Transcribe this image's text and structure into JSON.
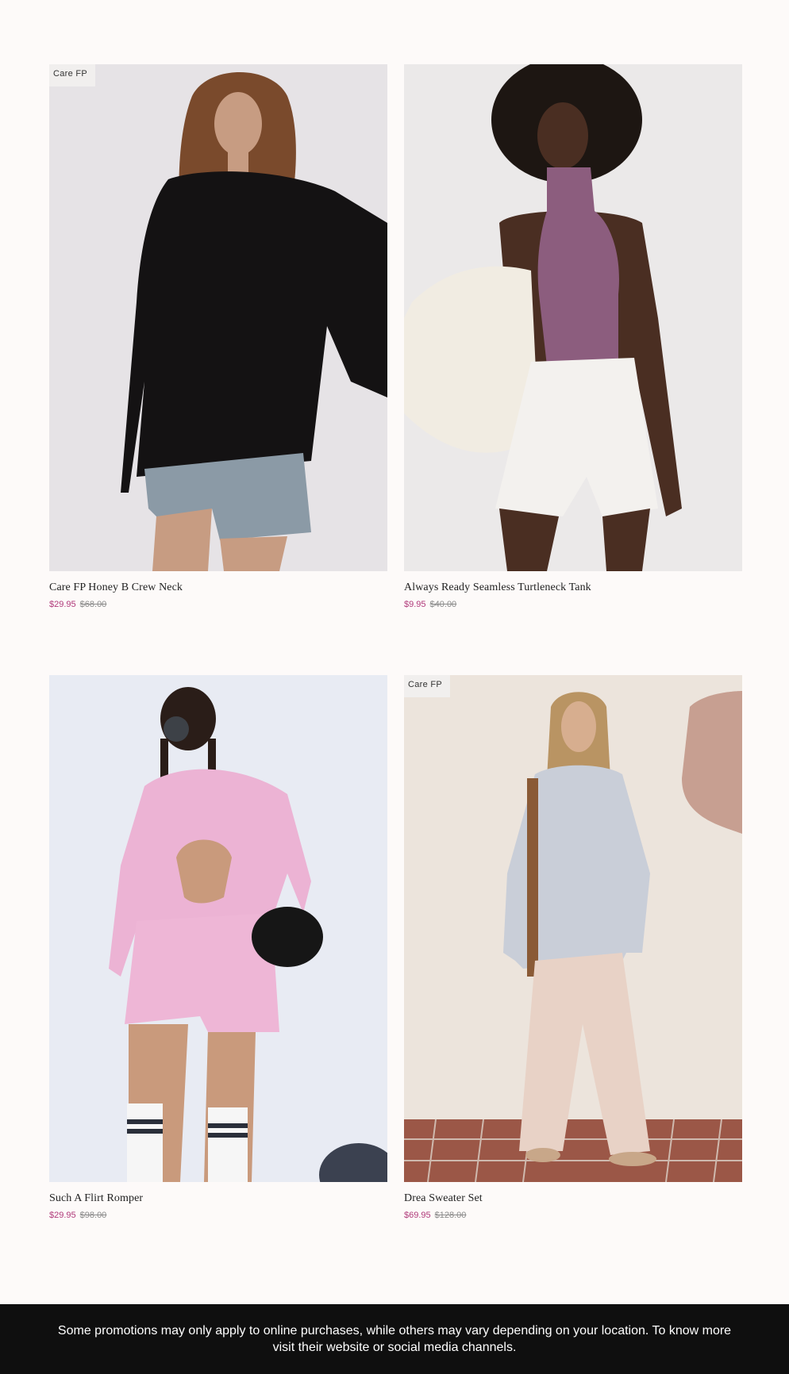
{
  "products": [
    {
      "badge": "Care FP",
      "title": "Care FP Honey B Crew Neck",
      "sale_price": "$29.95",
      "original_price": "$68.00",
      "colors": {
        "bg": "#e6e3e6",
        "top": "#141213",
        "bottom": "#8b9aa6",
        "skin": "#c79c82",
        "hair": "#7a4a2c"
      }
    },
    {
      "badge": "",
      "title": "Always Ready Seamless Turtleneck Tank",
      "sale_price": "$9.95",
      "original_price": "$40.00",
      "colors": {
        "bg": "#ebe9e9",
        "top": "#8c5d7e",
        "bottom": "#f3f1ee",
        "skin": "#4a2e22",
        "hair": "#1d1612"
      }
    },
    {
      "badge": "",
      "title": "Such A Flirt Romper",
      "sale_price": "$29.95",
      "original_price": "$98.00",
      "colors": {
        "bg": "#e8ebf3",
        "top": "#ecb3d4",
        "bottom": "#eeb6d6",
        "skin": "#c99a7c",
        "hair": "#2a1d18"
      }
    },
    {
      "badge": "Care FP",
      "title": "Drea Sweater Set",
      "sale_price": "$69.95",
      "original_price": "$128.00",
      "colors": {
        "bg": "#ece4dc",
        "top": "#c9ced8",
        "bottom": "#e8d2c6",
        "skin": "#d7ae8f",
        "hair": "#b99463"
      }
    }
  ],
  "footer": {
    "text": "Some promotions may only apply to online purchases, while others may vary depending on your location. To know more visit their website or social media channels."
  }
}
